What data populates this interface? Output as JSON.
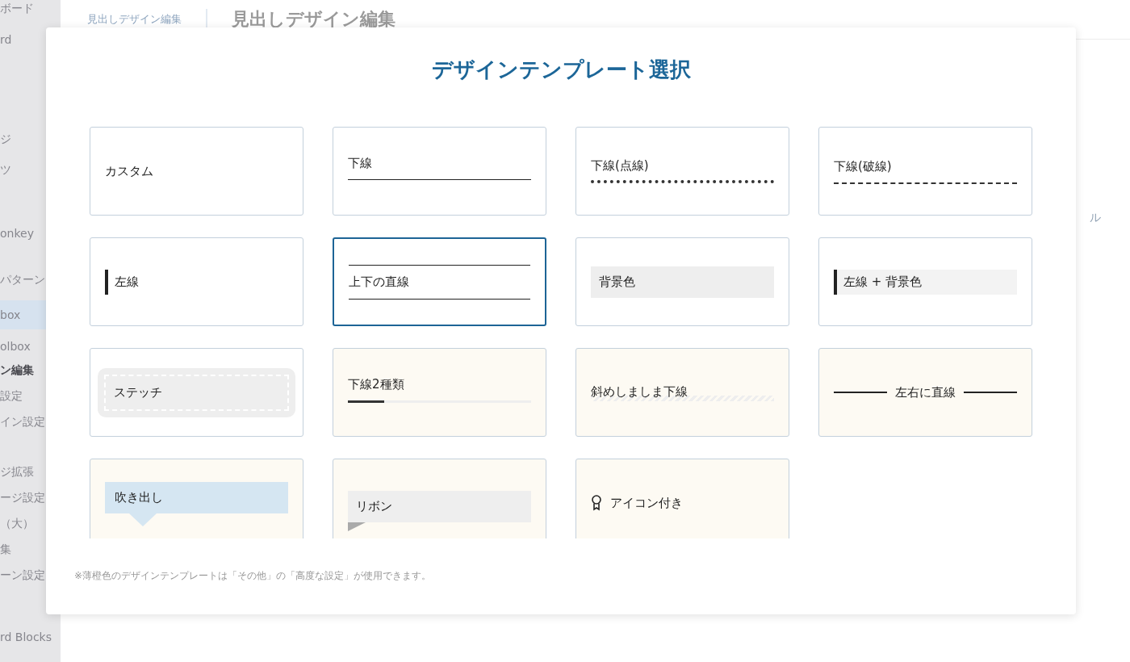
{
  "sidebar": {
    "items": [
      {
        "label": "ボード",
        "selected": false,
        "current": false
      },
      {
        "label": "rd",
        "selected": false,
        "current": false
      },
      {
        "label": "ジ",
        "selected": false,
        "current": false
      },
      {
        "label": "ツ",
        "selected": false,
        "current": false
      },
      {
        "label": "onkey",
        "selected": false,
        "current": false
      },
      {
        "label": "パターン",
        "selected": false,
        "current": false
      },
      {
        "label": "box",
        "selected": true,
        "current": false
      },
      {
        "label": "olbox",
        "selected": false,
        "current": false
      },
      {
        "label": "ン編集",
        "selected": false,
        "current": true
      },
      {
        "label": "設定",
        "selected": false,
        "current": false
      },
      {
        "label": "イン設定",
        "selected": false,
        "current": false
      },
      {
        "label": "ジ拡張",
        "selected": false,
        "current": false
      },
      {
        "label": "ージ設定",
        "selected": false,
        "current": false
      },
      {
        "label": "（大）",
        "selected": false,
        "current": false
      },
      {
        "label": "集",
        "selected": false,
        "current": false
      },
      {
        "label": "ーン設定",
        "selected": false,
        "current": false
      },
      {
        "label": "rd Blocks",
        "selected": false,
        "current": false
      }
    ]
  },
  "header": {
    "breadcrumb": "見出しデザイン編集",
    "title": "見出しデザイン編集"
  },
  "side_panel": {
    "label": "ル"
  },
  "dialog": {
    "title": "デザインテンプレート選択",
    "templates": [
      {
        "kind": "custom",
        "label": "カスタム",
        "selected": false,
        "premium": false
      },
      {
        "kind": "underline",
        "label": "下線",
        "selected": false,
        "premium": false
      },
      {
        "kind": "dotted",
        "label": "下線(点線)",
        "selected": false,
        "premium": false
      },
      {
        "kind": "dashed",
        "label": "下線(破線)",
        "selected": false,
        "premium": false
      },
      {
        "kind": "left_line",
        "label": "左線",
        "selected": false,
        "premium": false
      },
      {
        "kind": "top_bottom",
        "label": "上下の直線",
        "selected": true,
        "premium": false
      },
      {
        "kind": "background",
        "label": "背景色",
        "selected": false,
        "premium": false
      },
      {
        "kind": "left_bg",
        "label": "左線 + 背景色",
        "selected": false,
        "premium": false
      },
      {
        "kind": "stitch",
        "label": "ステッチ",
        "selected": false,
        "premium": false
      },
      {
        "kind": "two_underline",
        "label": "下線2種類",
        "selected": false,
        "premium": true
      },
      {
        "kind": "stripe",
        "label": "斜めしましま下線",
        "selected": false,
        "premium": true
      },
      {
        "kind": "side_lines",
        "label": "左右に直線",
        "selected": false,
        "premium": true
      },
      {
        "kind": "balloon",
        "label": "吹き出し",
        "selected": false,
        "premium": true
      },
      {
        "kind": "ribbon",
        "label": "リボン",
        "selected": false,
        "premium": true
      },
      {
        "kind": "icon",
        "label": "アイコン付き",
        "selected": false,
        "premium": true
      }
    ],
    "note": "※薄橙色のデザインテンプレートは「その他」の「高度な設定」が使用できます。"
  }
}
